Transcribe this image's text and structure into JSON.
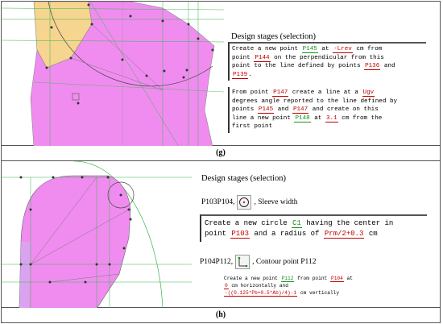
{
  "panel_g": {
    "caption": "(g)",
    "stage_title": "Design stages (selection)",
    "step1": {
      "t1": "Create a new point ",
      "p1": "P145",
      "t2": " at ",
      "v1": "-Lrev",
      "t3": " cm from",
      "t4": "point ",
      "p2": "P144",
      "t5": " on the perpendicular from this",
      "t6": "point to the line defined by points ",
      "p3": "P136",
      "t7": " and",
      "p4": "P139",
      "t8": "."
    },
    "step2": {
      "t1": "From point ",
      "p1": "P147",
      "t2": " create a line at a ",
      "v1": "Ugv",
      "t3": "degrees angle reported to the line defined by",
      "t4": "points ",
      "p2": "P145",
      "t5": " and ",
      "p3": "P147",
      "t6": " and create on this",
      "t7": "line a new point ",
      "p4": "P148",
      "t8": " at ",
      "v2": "3.1",
      "t9": " cm from the",
      "t10": "first point"
    }
  },
  "panel_h": {
    "caption": "(h)",
    "stage_title": "Design stages (selection)",
    "row1": {
      "label": "P103P104,",
      "after": ", Sleeve width",
      "icon": "circle-tool-icon"
    },
    "step1": {
      "t1": "Create a new circle ",
      "p1": "C1",
      "t2": " having the center in",
      "t3": "point ",
      "p2": "P103",
      "t4": " and a radius of ",
      "v1": "Prm/2+0.3",
      "t5": " cm"
    },
    "row2": {
      "label": "P104P112,",
      "after": ", Contour point P112",
      "icon": "contour-point-tool-icon"
    },
    "step2": {
      "t1": "Create a new point ",
      "p1": "P112",
      "t2": " from point ",
      "p2": "P104",
      "t3": " at",
      "v1": "0",
      "t4": " cm horizontally and",
      "v2": "-((0.125*Pb+0.5*Ab)/4)-1",
      "t5": " cm vertically"
    }
  },
  "colors": {
    "pattern_fill": "#f08cf0",
    "yoke_fill": "#f5d590",
    "point_green": "#1a8f1a",
    "value_red": "#c00000"
  }
}
